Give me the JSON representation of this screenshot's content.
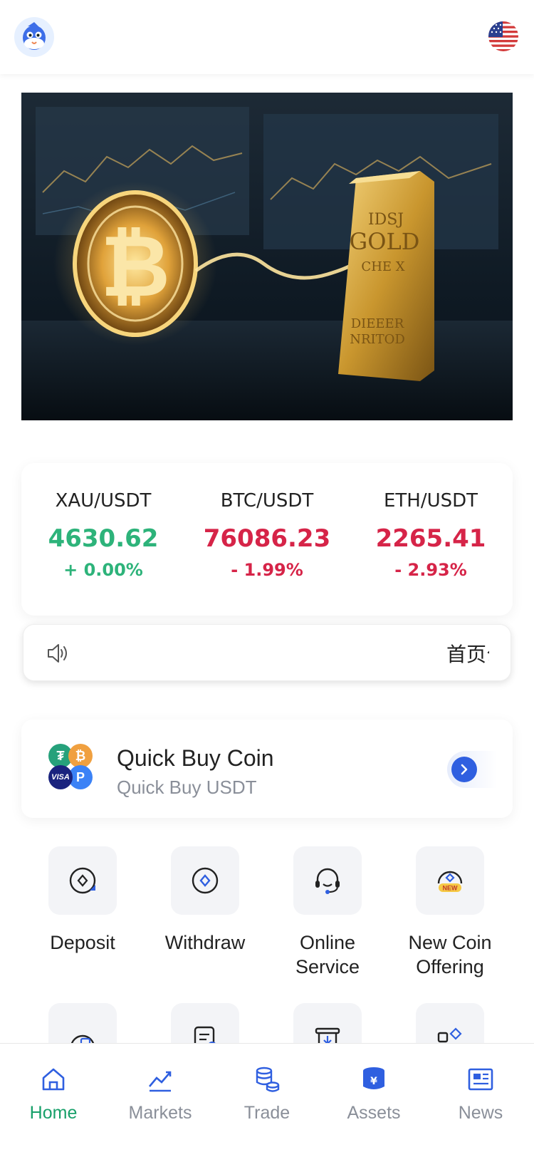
{
  "header": {
    "logo_icon": "mascot-logo-icon",
    "flag_icon": "us-flag-icon"
  },
  "banner": {
    "image": "bitcoin-and-gold-bar-banner",
    "bar_text": [
      "IDSJ",
      "GOLD",
      "CHE X",
      "DIEEER",
      "NRITOD"
    ]
  },
  "tickers": [
    {
      "symbol": "XAU/USDT",
      "price": "4630.62",
      "change": "+ 0.00%",
      "trend": "up"
    },
    {
      "symbol": "BTC/USDT",
      "price": "76086.23",
      "change": "- 1.99%",
      "trend": "down"
    },
    {
      "symbol": "ETH/USDT",
      "price": "2265.41",
      "change": "- 2.93%",
      "trend": "down"
    }
  ],
  "notice": {
    "icon": "speaker-icon",
    "text": "首页公告"
  },
  "quick_buy": {
    "title": "Quick Buy Coin",
    "subtitle": "Quick Buy USDT",
    "icons": [
      "tether-icon",
      "bitcoin-icon",
      "visa-icon",
      "paypal-icon"
    ],
    "visa_label": "VISA"
  },
  "actions": [
    {
      "label": "Deposit",
      "icon": "deposit-icon"
    },
    {
      "label": "Withdraw",
      "icon": "withdraw-icon"
    },
    {
      "label": "Online\nService",
      "icon": "headset-icon"
    },
    {
      "label": "New Coin\nOffering",
      "icon": "new-coin-icon",
      "badge": "NEW"
    }
  ],
  "nav": {
    "tabs": [
      {
        "label": "Home",
        "icon": "home-icon",
        "active": true
      },
      {
        "label": "Markets",
        "icon": "markets-icon",
        "active": false
      },
      {
        "label": "Trade",
        "icon": "trade-icon",
        "active": false
      },
      {
        "label": "Assets",
        "icon": "assets-icon",
        "active": false
      },
      {
        "label": "News",
        "icon": "news-icon",
        "active": false
      }
    ]
  },
  "colors": {
    "up": "#2db37a",
    "down": "#d62448",
    "accent": "#2f5fe0",
    "nav_active": "#18a06a"
  }
}
